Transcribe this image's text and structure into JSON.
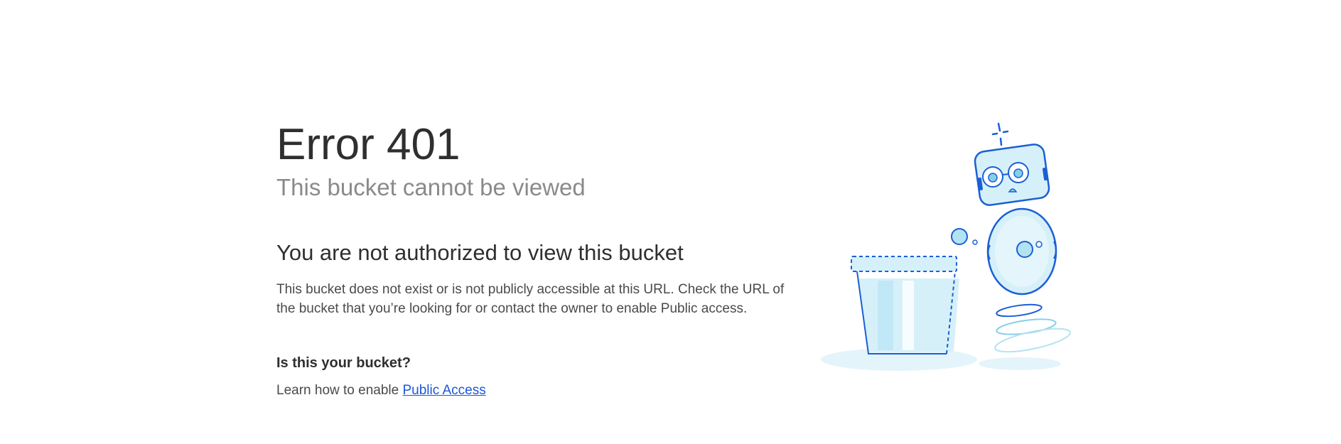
{
  "error": {
    "code_title": "Error 401",
    "subtitle": "This bucket cannot be viewed"
  },
  "message": {
    "heading": "You are not authorized to view this bucket",
    "body": "This bucket does not exist or is not publicly accessible at this URL. Check the URL of the bucket that you’re looking for or contact the owner to enable Public access."
  },
  "owner": {
    "question": "Is this your bucket?",
    "learn_prefix": "Learn how to enable ",
    "link_label": "Public Access"
  },
  "illustration": {
    "name": "robot-and-bucket-illustration",
    "colors": {
      "stroke": "#1a5fd6",
      "fill_light": "#d6f0f9",
      "fill_mid": "#b3e3f3",
      "shadow": "#e4f4fb"
    }
  }
}
